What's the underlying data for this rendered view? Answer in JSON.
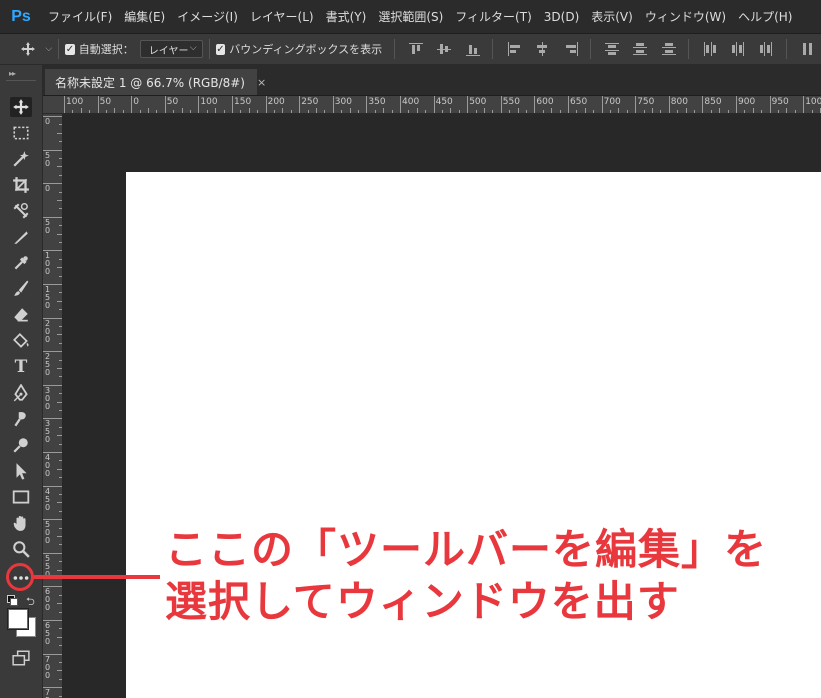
{
  "app": {
    "logo": "Ps"
  },
  "menu": {
    "items": [
      "ファイル(F)",
      "編集(E)",
      "イメージ(I)",
      "レイヤー(L)",
      "書式(Y)",
      "選択範囲(S)",
      "フィルター(T)",
      "3D(D)",
      "表示(V)",
      "ウィンドウ(W)",
      "ヘルプ(H)"
    ]
  },
  "options": {
    "auto_select_label": "自動選択：",
    "auto_select_checked": true,
    "layer_select_value": "レイヤー",
    "bounding_box_label": "バウンディングボックスを表示",
    "bounding_box_checked": true
  },
  "document": {
    "tab_title": "名称未設定 1 @ 66.7% (RGB/8#)",
    "tab_close": "×"
  },
  "ruler": {
    "top_labels": [
      "100",
      "50",
      "0",
      "50",
      "100",
      "150",
      "200",
      "250",
      "300",
      "350",
      "400",
      "450",
      "500",
      "550",
      "600",
      "650",
      "700",
      "750",
      "800",
      "850",
      "900",
      "950",
      "1000"
    ],
    "left_labels": [
      "0",
      "5 0",
      "0",
      "5 0",
      "1 0 0",
      "1 5 0",
      "2 0 0",
      "2 5 0",
      "3 0 0",
      "3 5 0",
      "4 0 0",
      "4 5 0",
      "5 0 0",
      "5 5 0",
      "6 0 0",
      "6 5 0",
      "7 0 0",
      "7 5 0"
    ]
  },
  "tools": [
    "move-tool",
    "marquee-tool",
    "magic-wand-tool",
    "crop-tool",
    "frame-tool",
    "eyedropper-ruler-tool",
    "eyedropper-tool",
    "brush-tool",
    "eraser-tool",
    "paint-bucket-tool",
    "type-tool",
    "pen-tool",
    "smudge-tool",
    "dodge-tool",
    "path-selection-tool",
    "rectangle-tool",
    "hand-tool",
    "zoom-tool",
    "edit-toolbar-button",
    "default-colors",
    "swap-colors",
    "color-swatches",
    "screen-mode"
  ],
  "annotation": {
    "line1": "ここの「ツールバーを編集」を",
    "line2": "選択してウィンドウを出す",
    "color": "#e8383d"
  },
  "colors": {
    "accent": "#31a8ff",
    "annotation": "#e8383d",
    "canvas": "#ffffff"
  }
}
